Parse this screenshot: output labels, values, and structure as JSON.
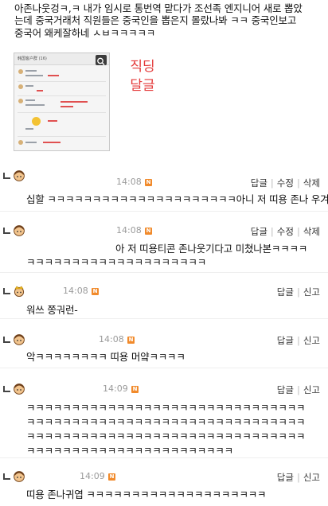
{
  "post": {
    "lines": [
      "아존나웃겅ㅋ,ㅋ 내가 임시로 통번역 맡다가 조선족 엔지니어 새로 뽑았",
      "는데 중국거래처 직원들은 중국인을 뽑은지 몰랐나봐 ㅋㅋ 중국인보고",
      "중국어 왜케잘하네 ㅅㅂㅋㅋㅋㅋㅋ"
    ],
    "thumbnail_title": "韩国客户群 (16)",
    "annotation": [
      "직딩",
      "달글"
    ]
  },
  "comments": [
    {
      "time": "14:08",
      "badge": "N",
      "actions": [
        "답글",
        "수정",
        "삭제"
      ],
      "lines": [
        "십할 ㅋㅋㅋㅋㅋㅋㅋㅋㅋㅋㅋㅋㅋㅋㅋㅋㅋㅋㅋㅋㅋ아니 저 띠용 존나 우겨"
      ]
    },
    {
      "time": "14:08",
      "badge": "N",
      "actions": [
        "답글",
        "수정",
        "삭제"
      ],
      "lines": [
        "아 저 띠용티콘 존나웃기다고 미쳤나본ㅋㅋㅋㅋ",
        "ㅋㅋㅋㅋㅋㅋㅋㅋㅋㅋㅋㅋㅋㅋㅋㅋㅋㅋㅋㅋ"
      ]
    },
    {
      "time": "14:08",
      "badge": "N",
      "actions": [
        "답글",
        "신고"
      ],
      "lines": [
        "워쓰 쫑궈런-"
      ]
    },
    {
      "time": "14:08",
      "badge": "N",
      "actions": [
        "답글",
        "신고"
      ],
      "lines": [
        "악ㅋㅋㅋㅋㅋㅋㅋㅋ 띠용 머얔ㅋㅋㅋㅋ"
      ]
    },
    {
      "time": "14:09",
      "badge": "N",
      "actions": [
        "답글",
        "신고"
      ],
      "lines": [
        "ㅋㅋㅋㅋㅋㅋㅋㅋㅋㅋㅋㅋㅋㅋㅋㅋㅋㅋㅋㅋㅋㅋㅋㅋㅋㅋㅋㅋㅋㅋㅋ",
        "ㅋㅋㅋㅋㅋㅋㅋㅋㅋㅋㅋㅋㅋㅋㅋㅋㅋㅋㅋㅋㅋㅋㅋㅋㅋㅋㅋㅋㅋㅋㅋ",
        "ㅋㅋㅋㅋㅋㅋㅋㅋㅋㅋㅋㅋㅋㅋㅋㅋㅋㅋㅋㅋㅋㅋㅋㅋㅋㅋㅋㅋㅋㅋㅋ",
        "ㅋㅋㅋㅋㅋㅋㅋㅋㅋㅋㅋㅋㅋㅋㅋㅋㅋㅋㅋㅋㅋㅋㅋ"
      ]
    },
    {
      "time": "14:09",
      "badge": "N",
      "actions": [
        "답글",
        "신고"
      ],
      "lines": [
        "띠용 존나귀엽 ㅋㅋㅋㅋㅋㅋㅋㅋㅋㅋㅋㅋㅋㅋㅋㅋㅋㅋㅋㅋ"
      ]
    }
  ]
}
